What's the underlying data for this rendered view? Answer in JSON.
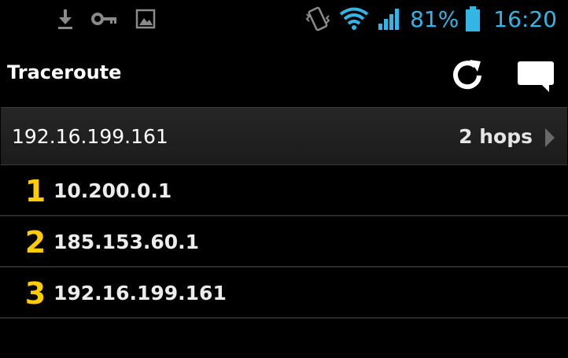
{
  "status_bar": {
    "notification_icons": [
      "download-icon",
      "key-icon",
      "image-icon"
    ],
    "battery_percent": "81%",
    "time": "16:20",
    "accent_color": "#33b5e5"
  },
  "action_bar": {
    "title": "Traceroute",
    "actions": [
      "refresh-icon",
      "comment-icon"
    ]
  },
  "target": {
    "ip": "192.16.199.161",
    "hops_label": "2 hops"
  },
  "hops": [
    {
      "number": "1",
      "ip": "10.200.0.1"
    },
    {
      "number": "2",
      "ip": "185.153.60.1"
    },
    {
      "number": "3",
      "ip": "192.16.199.161"
    }
  ],
  "colors": {
    "hop_number": "#ffcc00",
    "background": "#000000"
  }
}
